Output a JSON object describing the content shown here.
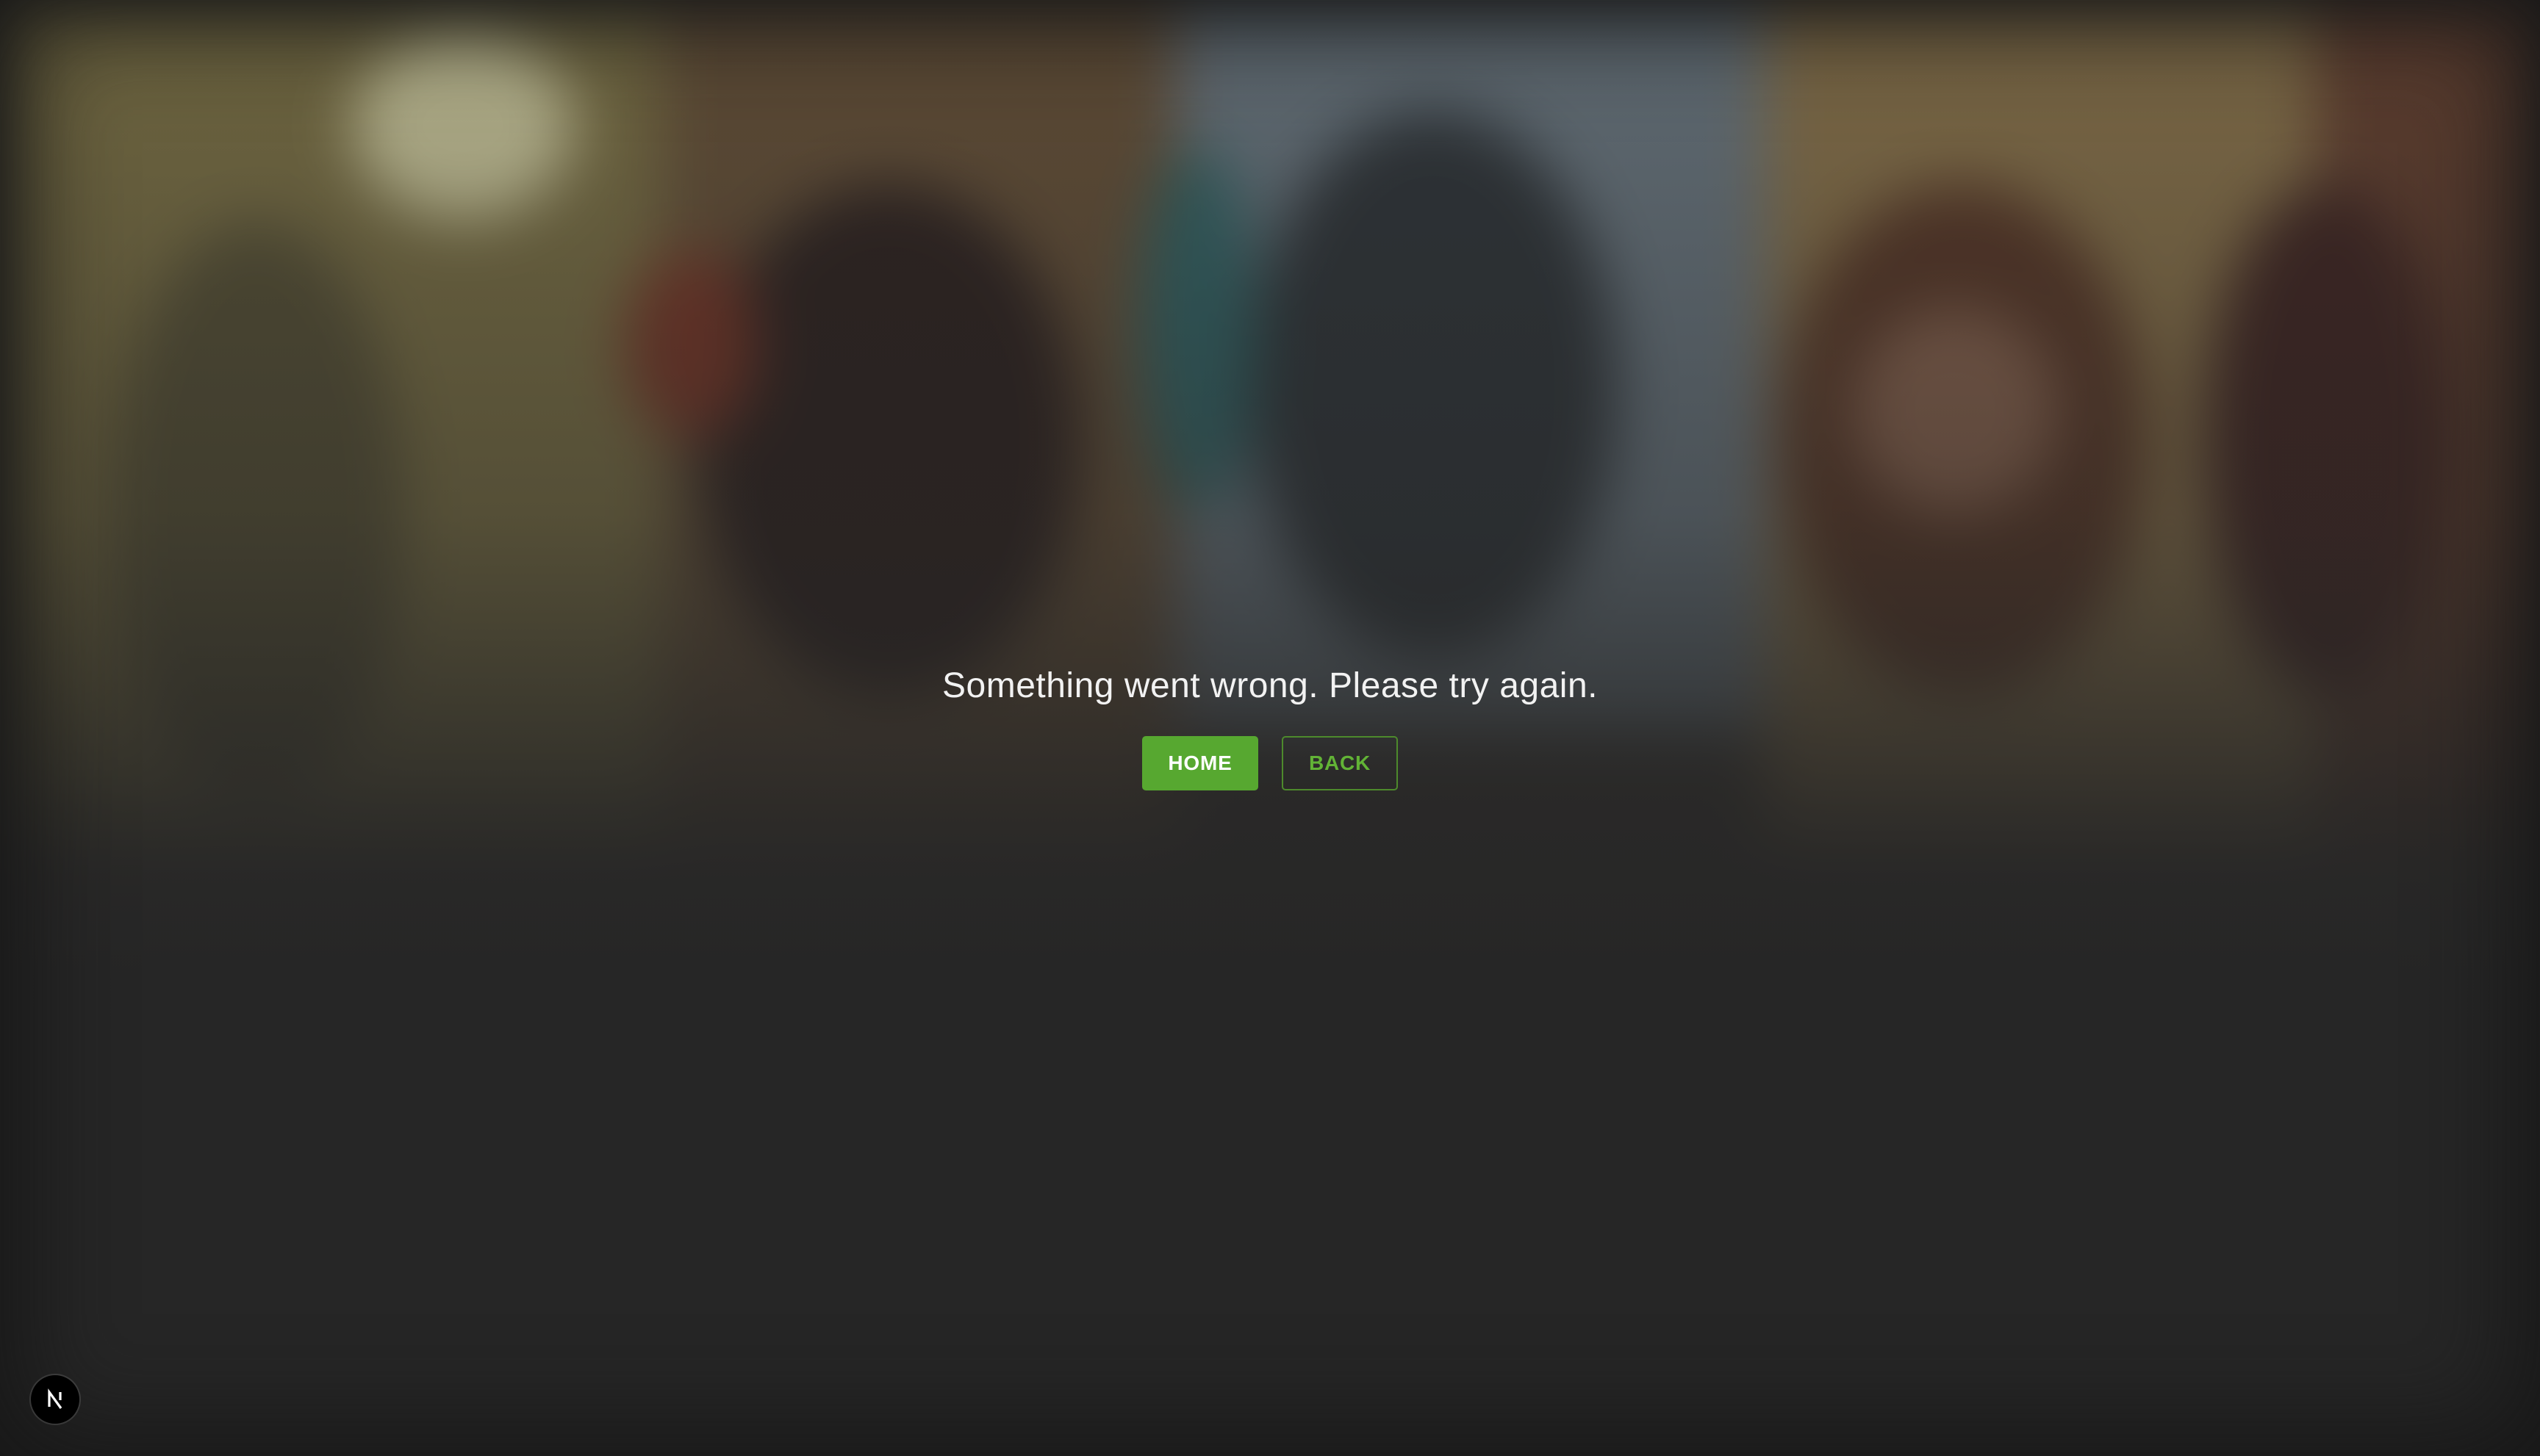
{
  "error": {
    "message": "Something went wrong. Please try again."
  },
  "actions": {
    "home_label": "HOME",
    "back_label": "BACK"
  },
  "badge": {
    "icon": "nextjs-logo-icon"
  },
  "colors": {
    "accent": "#57a830",
    "accent_text": "#62b336",
    "background": "#262626"
  }
}
